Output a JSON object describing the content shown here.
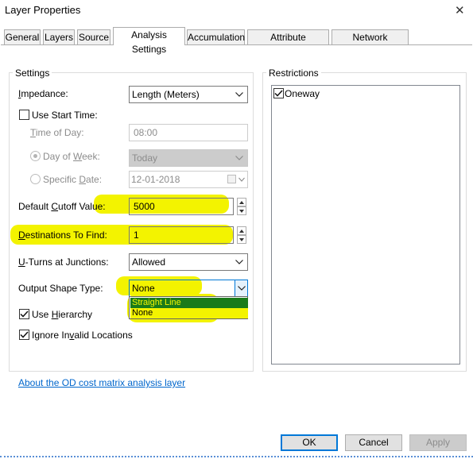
{
  "window": {
    "title": "Layer Properties"
  },
  "tabs": [
    {
      "label": "General"
    },
    {
      "label": "Layers"
    },
    {
      "label": "Source"
    },
    {
      "label": "Analysis Settings",
      "active": true
    },
    {
      "label": "Accumulation"
    },
    {
      "label": "Attribute Parameters"
    },
    {
      "label": "Network Locations"
    }
  ],
  "settings": {
    "group_label": "Settings",
    "impedance": {
      "label_pre": "",
      "label_u": "I",
      "label_post": "mpedance:",
      "value": "Length (Meters)"
    },
    "use_start_time": {
      "label": "Use Start Time:",
      "checked": false
    },
    "time_of_day": {
      "label_pre": "",
      "label_u": "T",
      "label_post": "ime of Day:",
      "value": "08:00"
    },
    "day_of_week": {
      "label_pre": "Day of ",
      "label_u": "W",
      "label_post": "eek:",
      "value": "Today",
      "selected": true
    },
    "specific_date": {
      "label_pre": "Specific ",
      "label_u": "D",
      "label_post": "ate:",
      "value": "12-01-2018",
      "selected": false
    },
    "default_cutoff": {
      "label_pre": "Default ",
      "label_u": "C",
      "label_post": "utoff Value:",
      "value": "5000"
    },
    "destinations": {
      "label_pre": "",
      "label_u": "D",
      "label_post": "estinations To Find:",
      "value": "1"
    },
    "uturns": {
      "label_pre": "",
      "label_u": "U",
      "label_post": "-Turns at Junctions:",
      "value": "Allowed"
    },
    "output_shape": {
      "label_pre": "Output Shape Type:",
      "label_u": "",
      "label_post": "",
      "value": "None"
    },
    "output_shape_options": [
      "Straight Line",
      "None"
    ],
    "use_hierarchy": {
      "label_pre": "Use ",
      "label_u": "H",
      "label_post": "ierarchy",
      "checked": true
    },
    "ignore_invalid": {
      "label_pre": "Ignore In",
      "label_u": "v",
      "label_post": "alid Locations",
      "checked": true
    }
  },
  "restrictions": {
    "group_label": "Restrictions",
    "items": [
      {
        "label": "Oneway",
        "checked": true
      }
    ]
  },
  "about_link": "About the OD cost matrix analysis layer",
  "buttons": {
    "ok": "OK",
    "cancel": "Cancel",
    "apply": "Apply"
  },
  "colors": {
    "highlight": "#f3f300",
    "link": "#0066cc",
    "selected_option_bg": "#1a7b1a",
    "focus_blue": "#0078d7"
  },
  "icons": {
    "close": "close-icon",
    "dropdown": "chevron-down-icon",
    "checkbox": "checkmark-icon",
    "calendar": "calendar-icon",
    "spinner": "spinner-arrows-icon"
  }
}
